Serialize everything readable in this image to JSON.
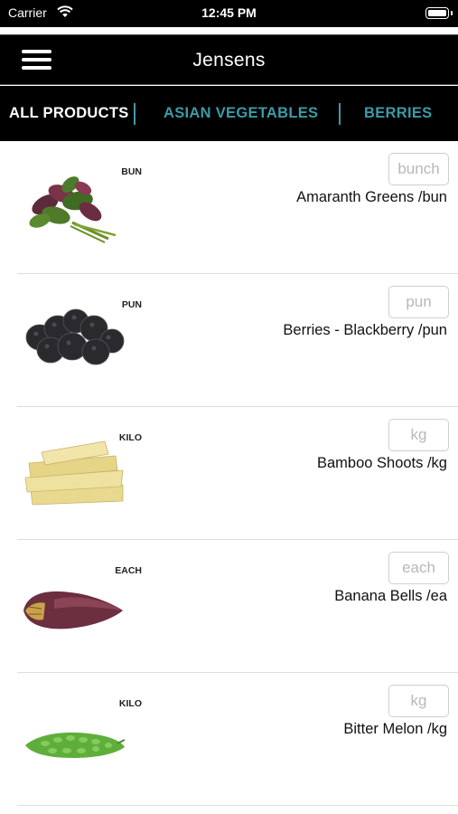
{
  "status_bar": {
    "carrier": "Carrier",
    "time": "12:45 PM"
  },
  "nav": {
    "title": "Jensens"
  },
  "tabs": [
    {
      "label": "ALL PRODUCTS",
      "active": true
    },
    {
      "label": "ASIAN VEGETABLES",
      "active": false
    },
    {
      "label": "BERRIES",
      "active": false
    }
  ],
  "colors": {
    "accent": "#3d9aa6",
    "bar_background": "#000000"
  },
  "products": [
    {
      "name": "Amaranth Greens /bun",
      "unit_tag": "BUN",
      "unit_placeholder": "bunch",
      "image": "amaranth-greens-image"
    },
    {
      "name": "Berries - Blackberry /pun",
      "unit_tag": "PUN",
      "unit_placeholder": "pun",
      "image": "blackberry-image"
    },
    {
      "name": "Bamboo Shoots /kg",
      "unit_tag": "KILO",
      "unit_placeholder": "kg",
      "image": "bamboo-shoots-image"
    },
    {
      "name": "Banana Bells /ea",
      "unit_tag": "EACH",
      "unit_placeholder": "each",
      "image": "banana-bells-image"
    },
    {
      "name": "Bitter Melon /kg",
      "unit_tag": "KILO",
      "unit_placeholder": "kg",
      "image": "bitter-melon-image"
    }
  ]
}
